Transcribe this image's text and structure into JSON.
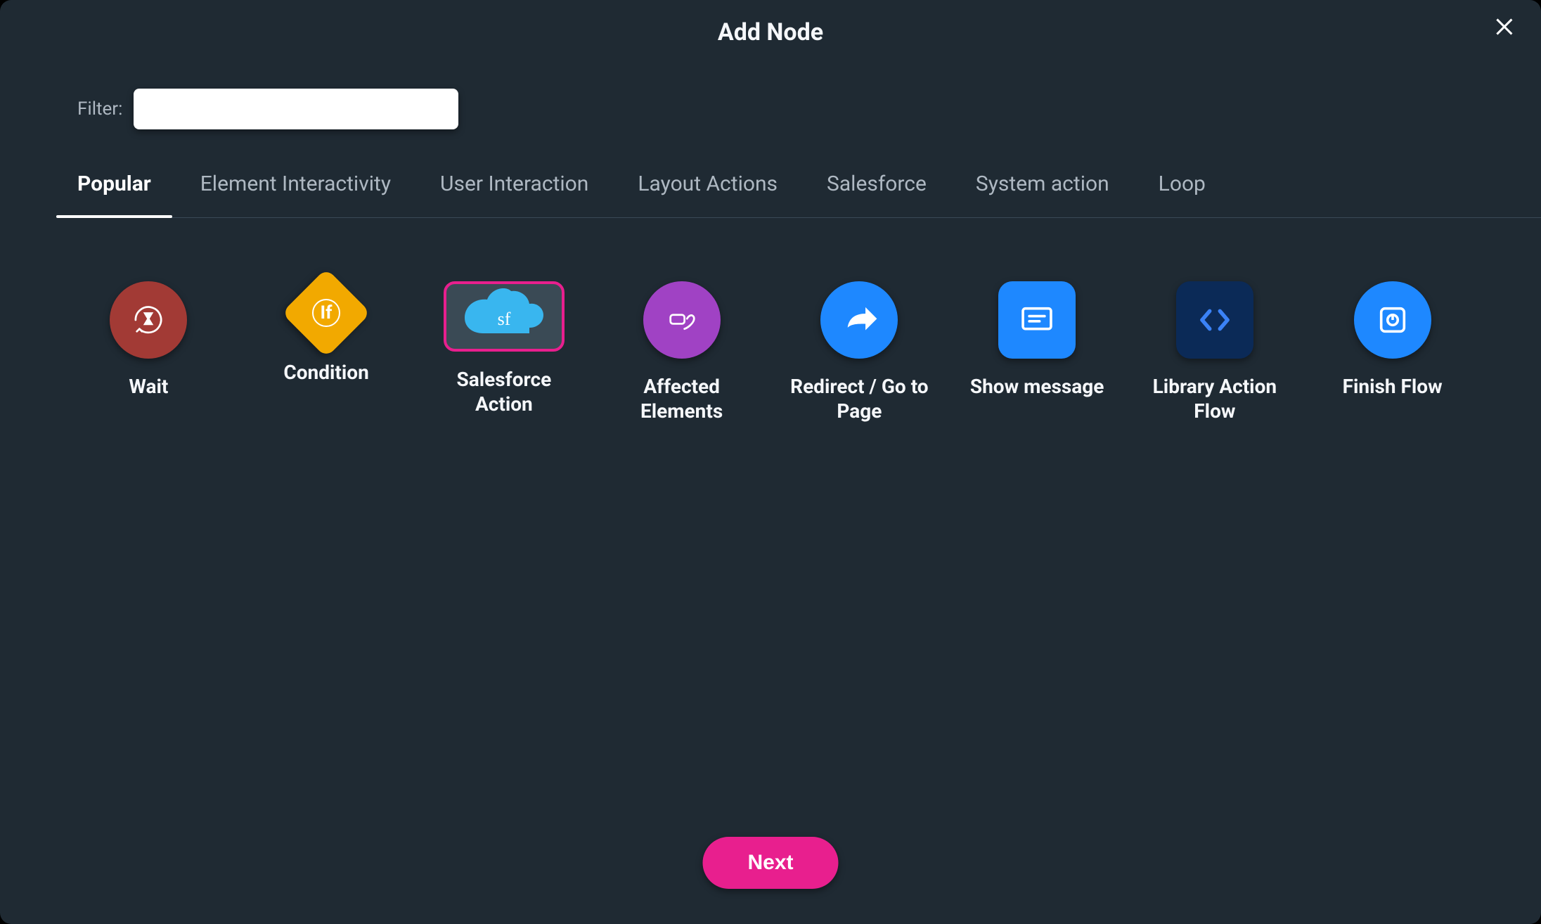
{
  "modal": {
    "title": "Add Node",
    "close_label": "Close"
  },
  "filter": {
    "label": "Filter:",
    "value": "",
    "placeholder": ""
  },
  "tabs": [
    {
      "id": "popular",
      "label": "Popular",
      "active": true
    },
    {
      "id": "element-interactivity",
      "label": "Element Interactivity",
      "active": false
    },
    {
      "id": "user-interaction",
      "label": "User Interaction",
      "active": false
    },
    {
      "id": "layout-actions",
      "label": "Layout Actions",
      "active": false
    },
    {
      "id": "salesforce",
      "label": "Salesforce",
      "active": false
    },
    {
      "id": "system-action",
      "label": "System action",
      "active": false
    },
    {
      "id": "loop",
      "label": "Loop",
      "active": false
    }
  ],
  "nodes": [
    {
      "id": "wait",
      "label": "Wait",
      "icon": "hourglass-arrow-icon",
      "shape": "circle",
      "bg": "bg-maroon",
      "selected": false
    },
    {
      "id": "condition",
      "label": "Condition",
      "icon": "if-diamond-icon",
      "shape": "diamond",
      "bg": "",
      "selected": false
    },
    {
      "id": "salesforce-action",
      "label": "Salesforce Action",
      "icon": "salesforce-cloud-icon",
      "shape": "cloud",
      "bg": "",
      "selected": true
    },
    {
      "id": "affected-elements",
      "label": "Affected Elements",
      "icon": "hand-tap-icon",
      "shape": "circle",
      "bg": "bg-purple",
      "selected": false
    },
    {
      "id": "redirect",
      "label": "Redirect / Go to Page",
      "icon": "share-arrow-icon",
      "shape": "circle",
      "bg": "bg-blue",
      "selected": false
    },
    {
      "id": "show-message",
      "label": "Show message",
      "icon": "message-lines-icon",
      "shape": "square",
      "bg": "bg-blue",
      "selected": false
    },
    {
      "id": "library-action-flow",
      "label": "Library Action Flow",
      "icon": "code-brackets-icon",
      "shape": "square",
      "bg": "bg-navy",
      "selected": false
    },
    {
      "id": "finish-flow",
      "label": "Finish Flow",
      "icon": "stop-square-icon",
      "shape": "circle",
      "bg": "bg-blue",
      "selected": false
    }
  ],
  "footer": {
    "next_label": "Next"
  },
  "colors": {
    "accent": "#e81f8e",
    "blue": "#1e88ff",
    "background": "#1f2a33"
  }
}
